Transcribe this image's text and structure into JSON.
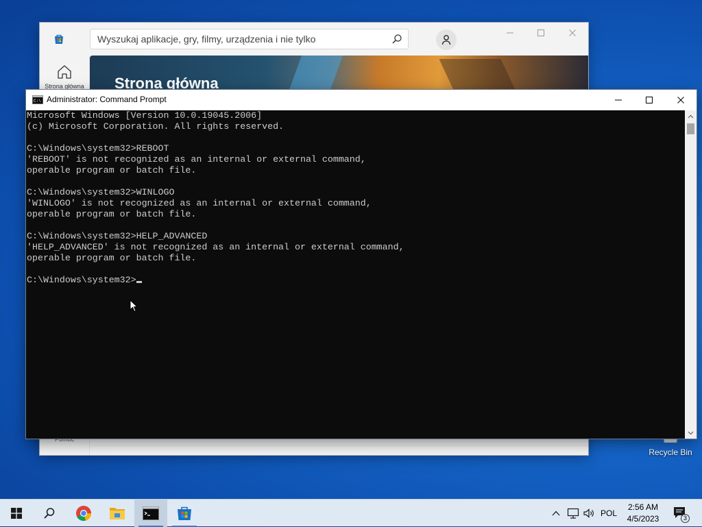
{
  "store": {
    "search_placeholder": "Wyszukaj aplikacje, gry, filmy, urządzenia i nie tylko",
    "nav_home_label": "Strona główna",
    "nav_help_label": "Pomoc",
    "hero_title": "Strona główna",
    "window_controls": [
      "minimize-icon",
      "maximize-icon",
      "close-icon"
    ]
  },
  "cmd": {
    "title": "Administrator: Command Prompt",
    "lines": [
      "Microsoft Windows [Version 10.0.19045.2006]",
      "(c) Microsoft Corporation. All rights reserved.",
      "",
      "C:\\Windows\\system32>REBOOT",
      "'REBOOT' is not recognized as an internal or external command,",
      "operable program or batch file.",
      "",
      "C:\\Windows\\system32>WINLOGO",
      "'WINLOGO' is not recognized as an internal or external command,",
      "operable program or batch file.",
      "",
      "C:\\Windows\\system32>HELP_ADVANCED",
      "'HELP_ADVANCED' is not recognized as an internal or external command,",
      "operable program or batch file.",
      "",
      "C:\\Windows\\system32>"
    ],
    "text_color": "#cccccc",
    "background_color": "#0c0c0c"
  },
  "desktop": {
    "recycle_bin_label": "Recycle Bin"
  },
  "taskbar": {
    "items": [
      "windows-start-icon",
      "search-icon",
      "chrome-icon",
      "file-explorer-icon",
      "command-prompt-icon",
      "microsoft-store-icon"
    ],
    "language": "POL",
    "time": "2:56 AM",
    "date": "4/5/2023",
    "notification_count": "3"
  },
  "colors": {
    "accent": "#0078d4",
    "desktop": "#1565c8",
    "taskbar": "#dfe9f4"
  }
}
